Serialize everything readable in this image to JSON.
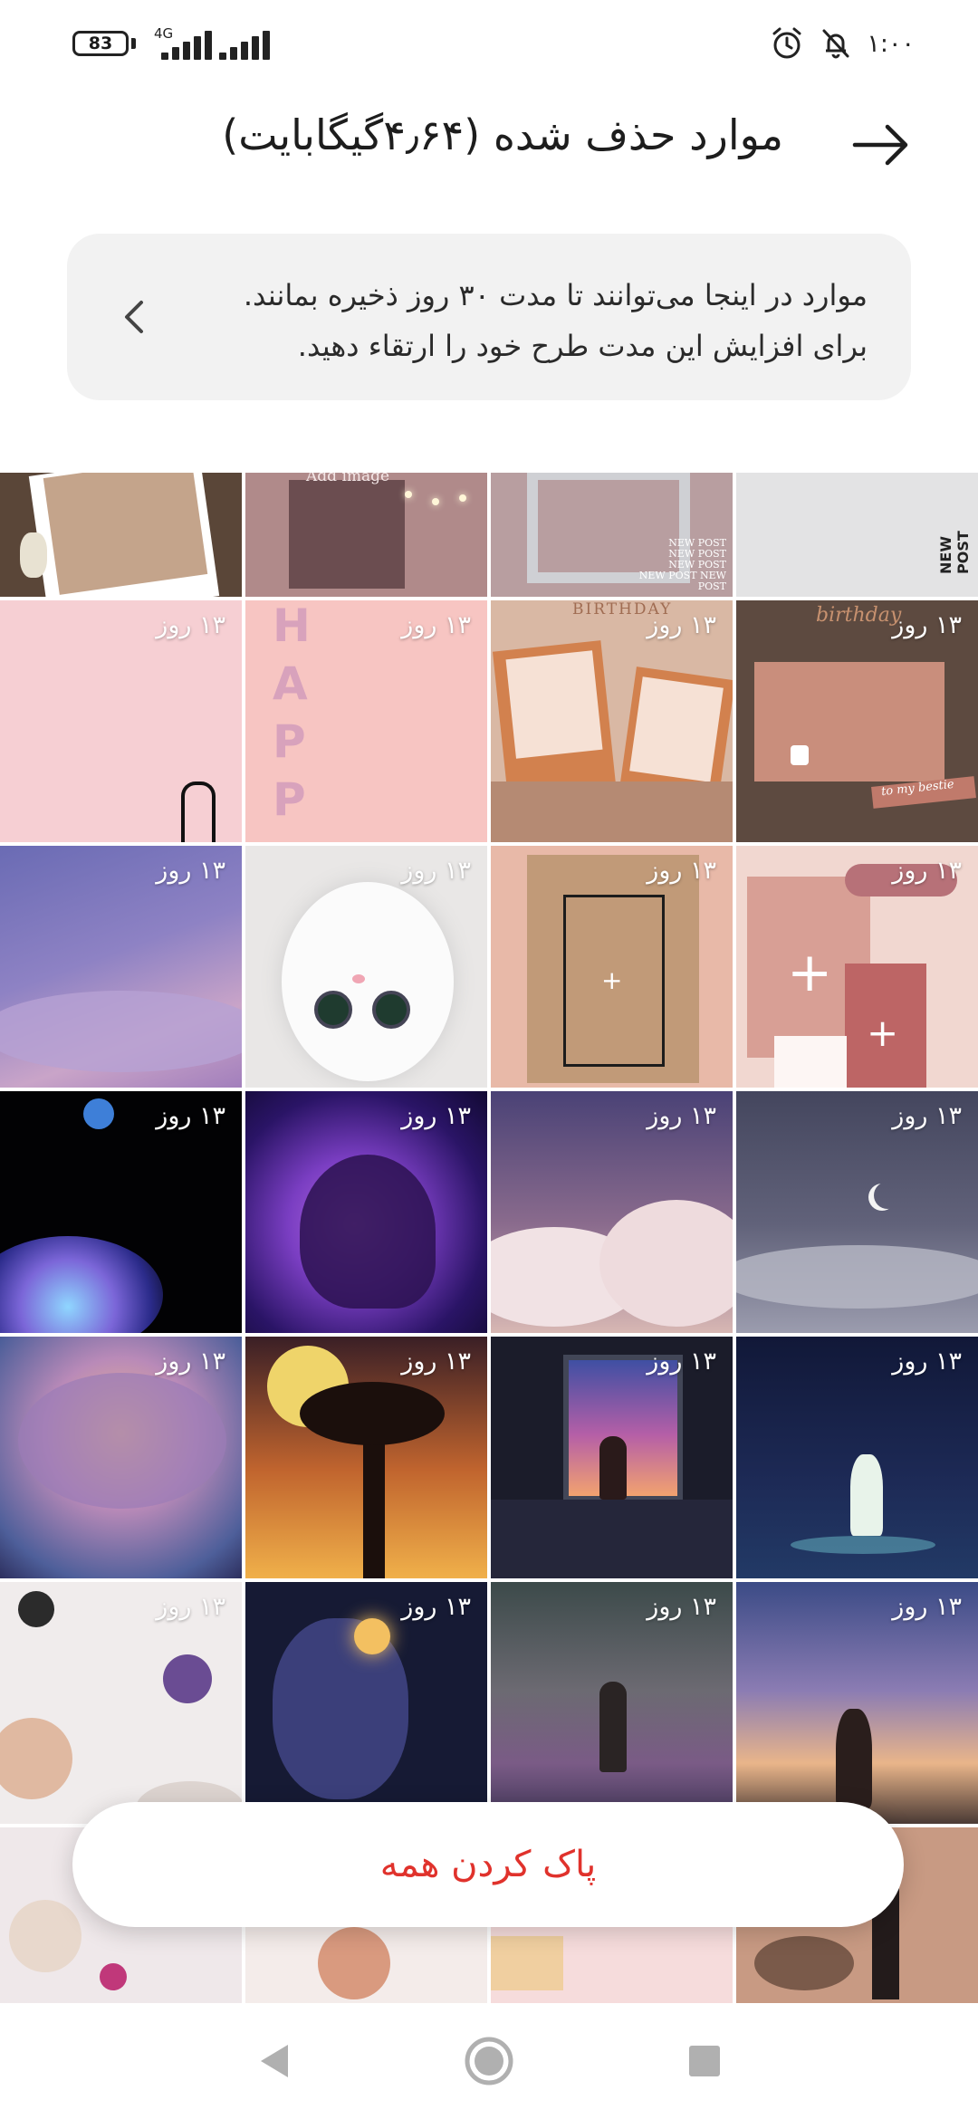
{
  "status_bar": {
    "battery": "83",
    "network": "4G",
    "time": "۱:۰۰",
    "icons": [
      "battery-icon",
      "signal-icon",
      "alarm-icon",
      "bell-off-icon"
    ]
  },
  "header": {
    "title": "موارد حذف شده (۴٫۶۴گیگابایت)",
    "back_icon": "arrow-right-icon"
  },
  "info_card": {
    "line1": "موارد در اینجا می‌توانند تا مدت ۳۰ روز ذخیره بمانند.",
    "line2": "برای افزایش این مدت طرح خود را ارتقاء دهید.",
    "chevron_icon": "chevron-left-icon"
  },
  "grid": {
    "days_label": "۱۳ روز",
    "top_row_texts": {
      "add_image": "Add image",
      "new_post": "NEW POST"
    },
    "tile_texts": {
      "birthday": "BIRTHDAY",
      "birthday_script": "birthday",
      "to_my_bestie": "to my bestie",
      "happy": "HAPPY"
    }
  },
  "actions": {
    "clear_all": "پاک کردن همه"
  },
  "nav_bar": {
    "icons": [
      "back-triangle-icon",
      "home-circle-icon",
      "recents-square-icon"
    ]
  }
}
